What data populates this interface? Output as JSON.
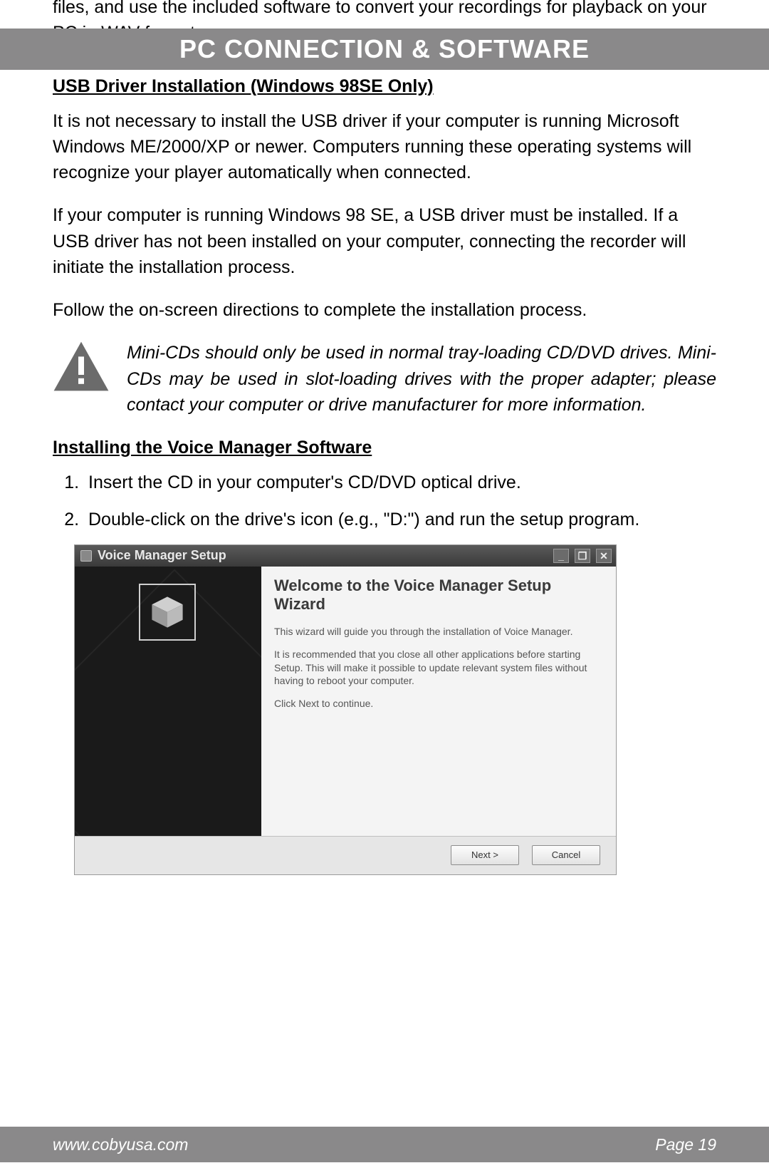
{
  "partial_top": "files, and use the included software to convert your recordings for playback on your PC in WAV format.",
  "banner": {
    "title": "PC CONNECTION & SOFTWARE"
  },
  "section1": {
    "heading": "USB Driver Installation (Windows 98SE Only)",
    "p1": "It is not necessary to install the USB driver if your computer is running Microsoft Windows ME/2000/XP or newer. Computers running these operating systems will recognize your player automatically when connected.",
    "p2": "If your computer is running Windows 98 SE, a USB driver must be installed. If a USB driver has not been installed on your computer, connecting the recorder will initiate the installation process.",
    "p3": "Follow the on-screen directions to complete the installation process."
  },
  "warning": {
    "icon": "warning-triangle-icon",
    "text": "Mini-CDs should only be used in normal tray-loading CD/DVD drives. Mini-CDs may be used in slot-loading drives with the proper adapter; please contact your computer or drive manufacturer for more information."
  },
  "section2": {
    "heading": "Installing the Voice Manager Software",
    "steps": [
      "Insert the CD in your computer's CD/DVD optical drive.",
      "Double-click on the drive's icon (e.g., \"D:\") and run the setup program."
    ]
  },
  "wizard": {
    "title": "Voice Manager Setup",
    "heading": "Welcome to the Voice Manager Setup Wizard",
    "p1": "This wizard will guide you through the installation of Voice Manager.",
    "p2": "It is recommended that you close all other applications before starting Setup. This will make it possible to update relevant system files without having to reboot your computer.",
    "p3": "Click Next to continue.",
    "buttons": {
      "next": "Next >",
      "cancel": "Cancel"
    },
    "winbtns": {
      "min": "_",
      "restore": "❐",
      "close": "✕"
    }
  },
  "footer": {
    "url": "www.cobyusa.com",
    "page": "Page 19"
  }
}
